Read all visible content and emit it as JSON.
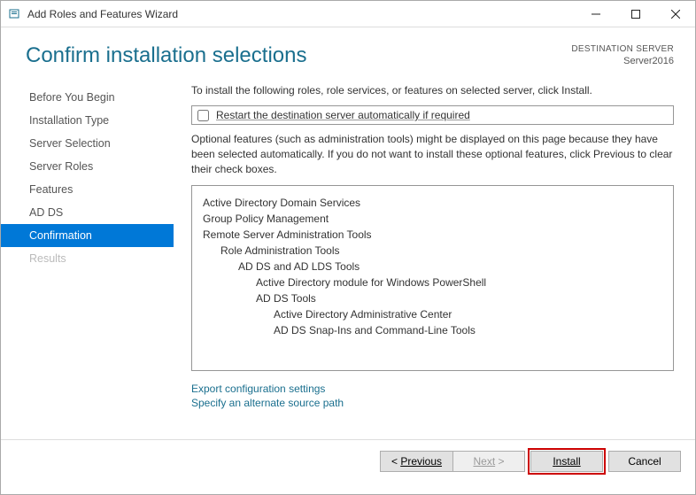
{
  "window": {
    "title": "Add Roles and Features Wizard"
  },
  "header": {
    "pageTitle": "Confirm installation selections",
    "destLabel": "DESTINATION SERVER",
    "destName": "Server2016"
  },
  "sidebar": {
    "steps": [
      {
        "label": "Before You Begin",
        "state": "normal"
      },
      {
        "label": "Installation Type",
        "state": "normal"
      },
      {
        "label": "Server Selection",
        "state": "normal"
      },
      {
        "label": "Server Roles",
        "state": "normal"
      },
      {
        "label": "Features",
        "state": "normal"
      },
      {
        "label": "AD DS",
        "state": "normal"
      },
      {
        "label": "Confirmation",
        "state": "active"
      },
      {
        "label": "Results",
        "state": "disabled"
      }
    ]
  },
  "content": {
    "intro": "To install the following roles, role services, or features on selected server, click Install.",
    "restartCheckbox": "Restart the destination server automatically if required",
    "optionalNote": "Optional features (such as administration tools) might be displayed on this page because they have been selected automatically. If you do not want to install these optional features, click Previous to clear their check boxes.",
    "tree": [
      {
        "label": "Active Directory Domain Services",
        "level": 0
      },
      {
        "label": "Group Policy Management",
        "level": 0
      },
      {
        "label": "Remote Server Administration Tools",
        "level": 0
      },
      {
        "label": "Role Administration Tools",
        "level": 1
      },
      {
        "label": "AD DS and AD LDS Tools",
        "level": 2
      },
      {
        "label": "Active Directory module for Windows PowerShell",
        "level": 3
      },
      {
        "label": "AD DS Tools",
        "level": 3
      },
      {
        "label": "Active Directory Administrative Center",
        "level": 4
      },
      {
        "label": "AD DS Snap-Ins and Command-Line Tools",
        "level": 4
      }
    ],
    "links": {
      "export": "Export configuration settings",
      "altSource": "Specify an alternate source path"
    }
  },
  "footer": {
    "previous": "Previous",
    "next": "Next",
    "install": "Install",
    "cancel": "Cancel"
  }
}
